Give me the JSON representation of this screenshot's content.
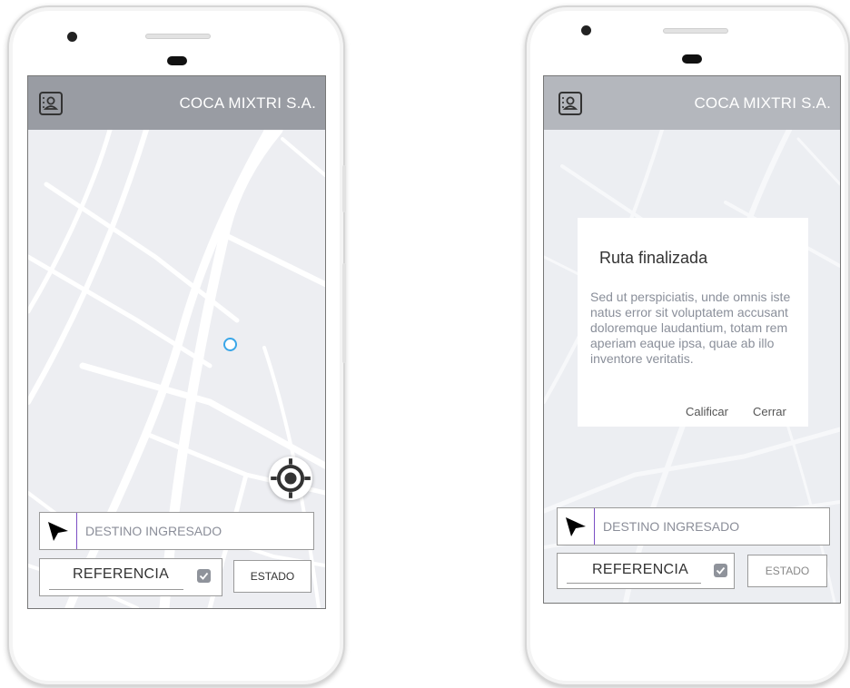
{
  "colors": {
    "header_left": "#999ca3",
    "header_right": "#b4b7bd",
    "map_bg": "#edeef2",
    "road": "#ffffff",
    "location_dot": "#3aa6e8",
    "accent_purple": "#7b4fc4",
    "checkbox": "#8f939b"
  },
  "left_phone": {
    "header": {
      "brand": "COCA MIXTRI S.A.",
      "logo_icon": "contact-book-icon"
    },
    "destination": {
      "placeholder": "DESTINO INGRESADO",
      "icon": "navigation-arrow-icon"
    },
    "reference": {
      "label": "REFERENCIA",
      "checked": true
    },
    "status_button": {
      "label": "ESTADO"
    },
    "locate_button": {
      "icon": "my-location-icon"
    },
    "location_marker": {
      "icon": "location-dot-icon"
    }
  },
  "right_phone": {
    "header": {
      "brand": "COCA MIXTRI S.A.",
      "logo_icon": "contact-book-icon"
    },
    "dialog": {
      "title": "Ruta finalizada",
      "body": "Sed ut perspiciatis, unde omnis iste natus error sit voluptatem accusant doloremque laudantium, totam rem aperiam eaque ipsa, quae ab illo inventore veritatis.",
      "actions": [
        "Calificar",
        "Cerrar"
      ]
    },
    "destination": {
      "placeholder": "DESTINO INGRESADO",
      "icon": "navigation-arrow-icon"
    },
    "reference": {
      "label": "REFERENCIA",
      "checked": true
    },
    "status_button": {
      "label": "ESTADO"
    }
  }
}
